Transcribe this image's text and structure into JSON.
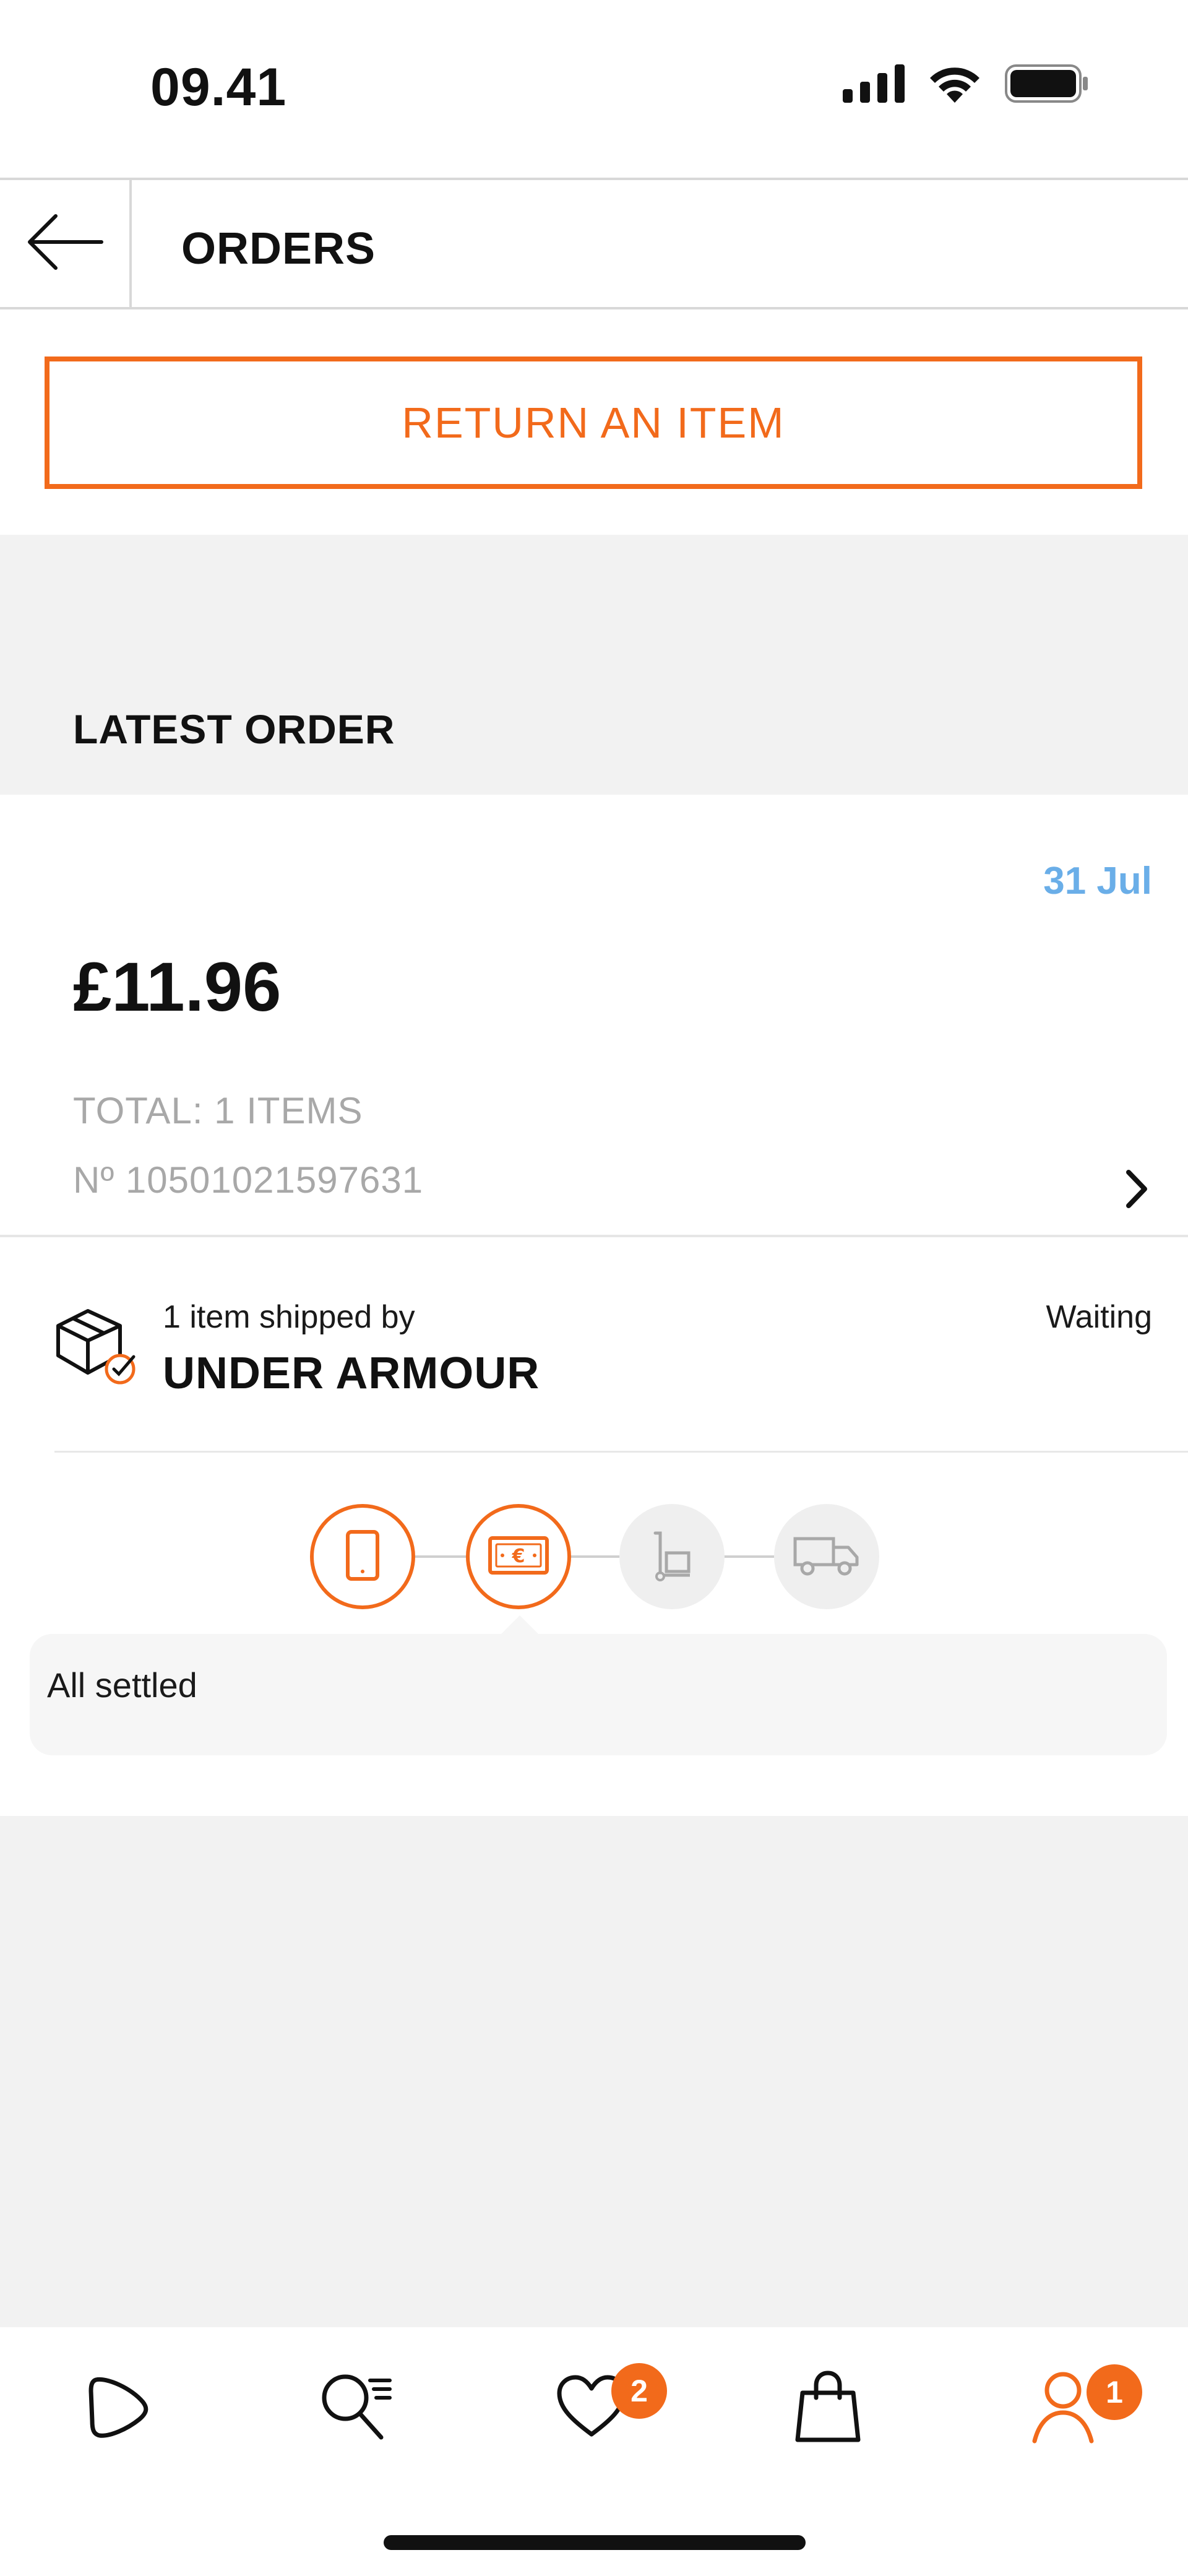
{
  "status_bar": {
    "time": "09.41",
    "icons": [
      "cellular-signal-icon",
      "wifi-icon",
      "battery-icon"
    ]
  },
  "header": {
    "back_icon": "arrow-left-icon",
    "title": "ORDERS"
  },
  "return_button": {
    "label": "RETURN AN ITEM"
  },
  "latest_order": {
    "section_title": "LATEST ORDER",
    "date": "31 Jul",
    "amount": "£11.96",
    "total_label": "TOTAL: 1 ITEMS",
    "order_number": "Nº 10501021597631"
  },
  "shipment": {
    "label": "1 item shipped by",
    "brand": "UNDER ARMOUR",
    "status": "Waiting",
    "steps": [
      {
        "icon": "phone-icon",
        "state": "active"
      },
      {
        "icon": "banknote-euro-icon",
        "state": "active"
      },
      {
        "icon": "hand-truck-icon",
        "state": "inactive"
      },
      {
        "icon": "delivery-truck-icon",
        "state": "inactive"
      }
    ],
    "step_message": "All settled"
  },
  "tabbar": {
    "items": [
      {
        "name": "home",
        "icon": "play-shape-icon"
      },
      {
        "name": "search",
        "icon": "search-list-icon"
      },
      {
        "name": "wishlist",
        "icon": "heart-icon",
        "badge": "2"
      },
      {
        "name": "bag",
        "icon": "shopping-bag-icon"
      },
      {
        "name": "account",
        "icon": "user-icon",
        "badge": "1",
        "active": true
      }
    ]
  },
  "colors": {
    "accent": "#f26a1b",
    "date": "#6aaee8",
    "muted": "#a8a8a8",
    "section_bg": "#f2f2f2"
  }
}
